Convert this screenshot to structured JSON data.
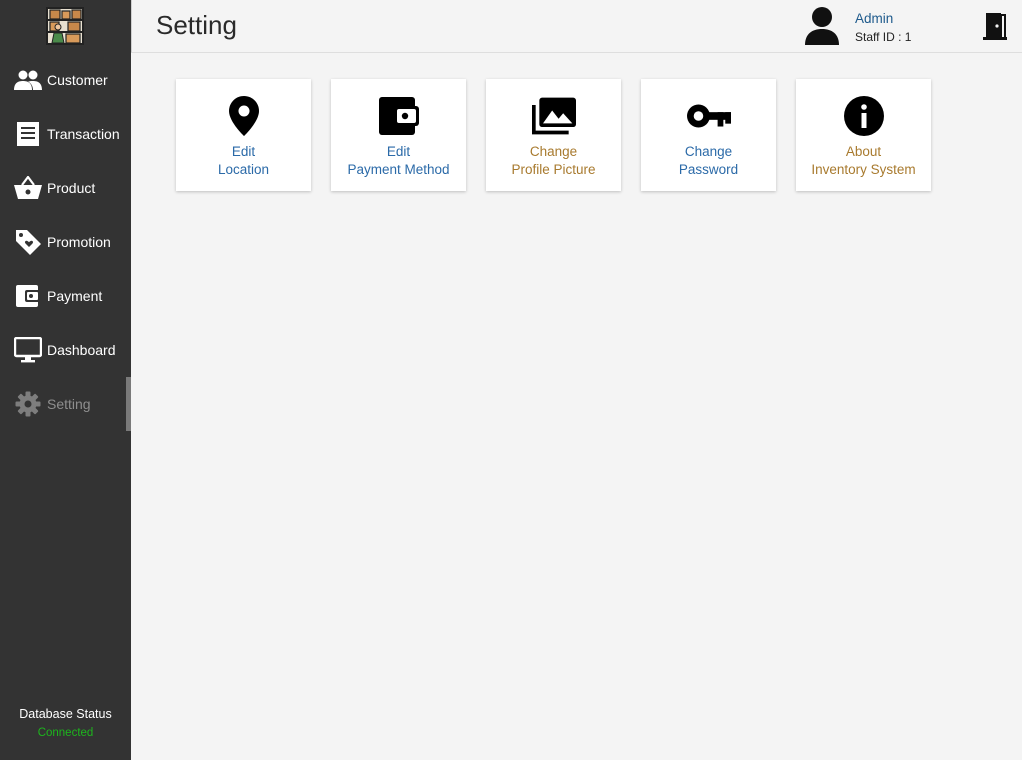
{
  "sidebar": {
    "items": [
      {
        "label": "Customer",
        "icon": "people-icon"
      },
      {
        "label": "Transaction",
        "icon": "receipt-icon"
      },
      {
        "label": "Product",
        "icon": "basket-icon"
      },
      {
        "label": "Promotion",
        "icon": "tag-heart-icon"
      },
      {
        "label": "Payment",
        "icon": "wallet-icon"
      },
      {
        "label": "Dashboard",
        "icon": "monitor-icon"
      },
      {
        "label": "Setting",
        "icon": "gear-icon",
        "active": true
      }
    ],
    "db_status_label": "Database Status",
    "db_status_value": "Connected"
  },
  "header": {
    "title": "Setting",
    "user_name": "Admin",
    "staff_id": "Staff ID :  1"
  },
  "cards": [
    {
      "line1": "Edit",
      "line2": "Location",
      "icon": "map-pin-icon"
    },
    {
      "line1": "Edit",
      "line2": "Payment Method",
      "icon": "wallet-icon"
    },
    {
      "line1": "Change",
      "line2": "Profile Picture",
      "icon": "photo-library-icon"
    },
    {
      "line1": "Change",
      "line2": "Password",
      "icon": "key-icon"
    },
    {
      "line1": "About",
      "line2": "Inventory System",
      "icon": "info-icon"
    }
  ],
  "colors": {
    "sidebar_bg": "#333333",
    "link_blue": "#2b6aa8",
    "link_gold": "#a87a2e",
    "status_green": "#1db51d"
  }
}
